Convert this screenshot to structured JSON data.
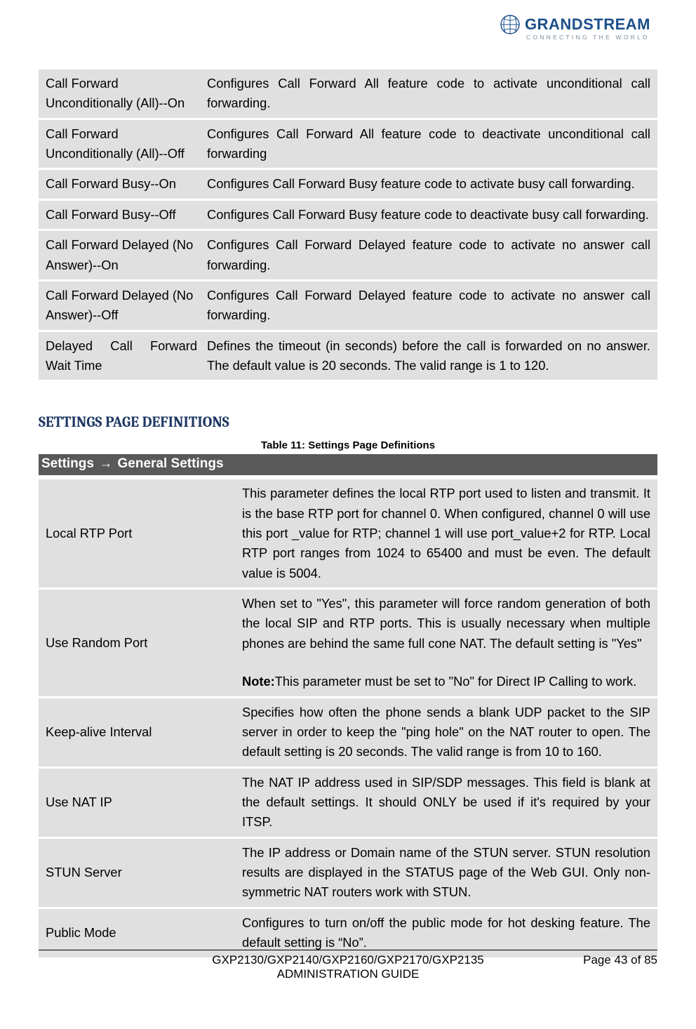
{
  "logo": {
    "name": "GRANDSTREAM",
    "tagline": "CONNECTING THE WORLD"
  },
  "table1": {
    "rows": [
      {
        "label": "Call Forward Unconditionally (All)--On",
        "desc": "Configures Call Forward All feature code to activate unconditional call forwarding."
      },
      {
        "label": "Call Forward Unconditionally (All)--Off",
        "desc": "Configures Call Forward All feature code to deactivate unconditional call forwarding"
      },
      {
        "label": "Call Forward Busy--On",
        "desc": "Configures Call Forward Busy feature code to activate busy call forwarding."
      },
      {
        "label": "Call Forward Busy--Off",
        "desc": "Configures Call Forward Busy feature code to deactivate busy call forwarding."
      },
      {
        "label": "Call Forward Delayed (No Answer)--On",
        "desc": "Configures Call Forward Delayed feature code to activate no answer call forwarding."
      },
      {
        "label": "Call Forward Delayed (No Answer)--Off",
        "desc": "Configures Call Forward Delayed feature code to activate no answer call forwarding."
      },
      {
        "label": "Delayed Call Forward Wait Time",
        "desc": "Defines the timeout (in seconds) before the call is forwarded on no answer. The default value is 20 seconds. The valid range is 1 to 120."
      }
    ]
  },
  "section_heading": "SETTINGS PAGE DEFINITIONS",
  "table2_caption": "Table 11: Settings Page Definitions",
  "path": {
    "left": "Settings",
    "arrow": "→",
    "right": "General Settings"
  },
  "table2": {
    "rows": [
      {
        "label": "Local RTP Port",
        "desc": "This parameter defines the local RTP port used to listen and transmit. It is the base RTP port for channel 0. When configured, channel 0 will use this port _value for RTP; channel 1 will use port_value+2 for RTP. Local RTP port ranges from 1024 to 65400 and must be even. The default value is 5004."
      },
      {
        "label": "Use Random Port",
        "desc_main": "When set to \"Yes\", this parameter will force random generation of both the local SIP and RTP ports. This is usually necessary when multiple phones are behind the same full cone NAT. The default setting is \"Yes\"",
        "note_label": "Note:",
        "note_text": "This parameter must be set to \"No\" for Direct IP Calling to work."
      },
      {
        "label": "Keep-alive Interval",
        "desc": "Specifies how often the phone sends a blank UDP packet to the SIP server in order to keep the \"ping hole\" on the NAT router to open. The default setting is 20 seconds. The valid range is from 10 to 160."
      },
      {
        "label": "Use NAT IP",
        "desc": "The NAT IP address used in SIP/SDP messages. This field is blank at the default settings. It should ONLY be used if it's required by your ITSP."
      },
      {
        "label": "STUN Server",
        "desc": "The IP address or Domain name of the STUN server. STUN resolution results are displayed in the STATUS page of the Web GUI. Only non-symmetric NAT routers work with STUN."
      },
      {
        "label": "Public Mode",
        "desc": "Configures to turn on/off the public mode for hot desking feature. The default setting is “No”."
      }
    ]
  },
  "footer": {
    "line1": "GXP2130/GXP2140/GXP2160/GXP2170/GXP2135",
    "line2": "ADMINISTRATION GUIDE",
    "page": "Page 43 of 85"
  }
}
